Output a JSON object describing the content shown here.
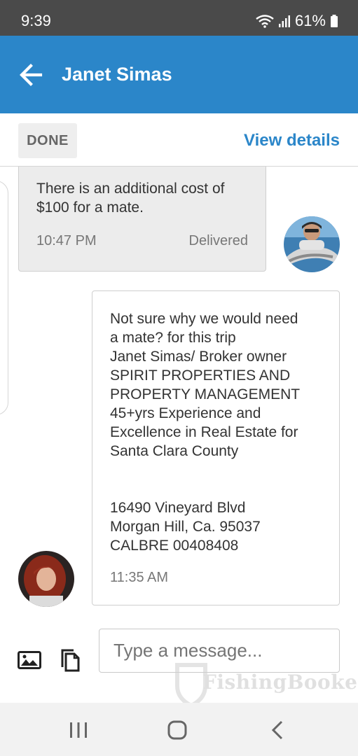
{
  "status_bar": {
    "time": "9:39",
    "battery": "61%"
  },
  "header": {
    "title": "Janet Simas"
  },
  "toolbar": {
    "done_label": "DONE",
    "view_details_label": "View details"
  },
  "messages": [
    {
      "direction": "incoming",
      "text": "There is an additional cost of\n$100 for a mate.",
      "time": "10:47 PM",
      "status": "Delivered"
    },
    {
      "direction": "outgoing",
      "text": "Not sure why we would need\na mate? for this trip\nJanet Simas/ Broker owner\nSPIRIT PROPERTIES AND\nPROPERTY MANAGEMENT\n45+yrs Experience and\nExcellence in Real Estate for\nSanta Clara County\n\n\n16490 Vineyard Blvd\nMorgan Hill, Ca. 95037\nCALBRE 00408408",
      "time": "11:35 AM"
    }
  ],
  "composer": {
    "placeholder": "Type a message..."
  },
  "watermark": {
    "brand": "FishingBooker"
  },
  "colors": {
    "accent": "#2b86c9",
    "status_bar": "#4a4a4a"
  }
}
